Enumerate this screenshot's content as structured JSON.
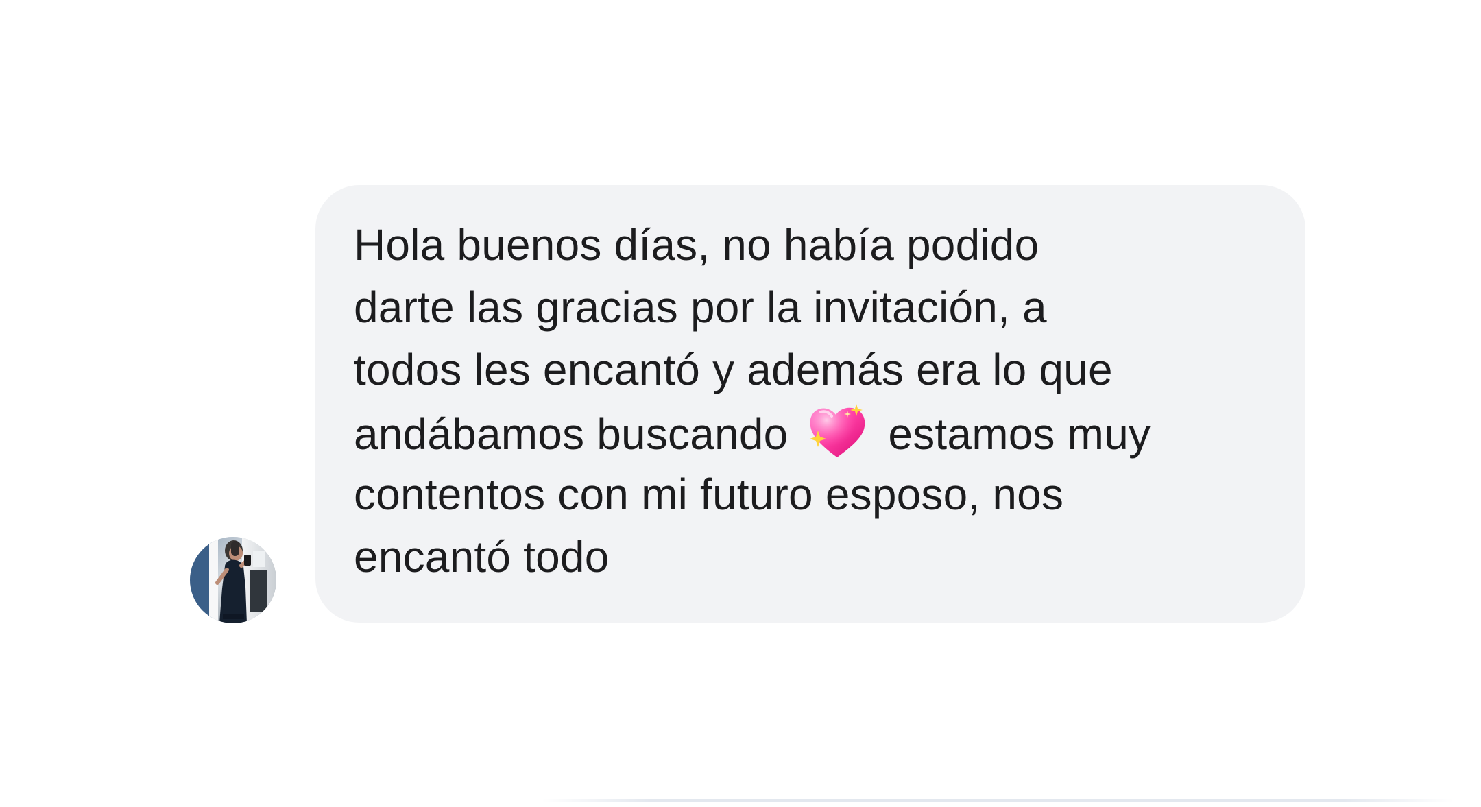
{
  "conversation": {
    "message": {
      "lines": [
        "Hola buenos días, no había podido",
        "darte las gracias por la invitación, a",
        "todos les encantó y además era lo que",
        "andábamos buscando",
        "estamos muy",
        "contentos con mi futuro esposo, nos",
        "encantó todo"
      ],
      "emoji": "sparkling-heart-icon"
    },
    "avatar": {
      "icon": "profile-photo"
    }
  },
  "colors": {
    "background": "#ffffff",
    "bubble": "#f2f3f5",
    "text": "#1c1c1e",
    "emoji_heart": "#ff3fa4",
    "emoji_sparkle": "#ffd43b"
  }
}
